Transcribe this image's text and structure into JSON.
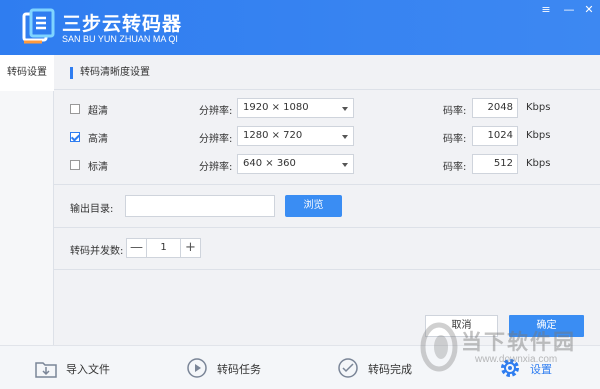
{
  "app": {
    "title": "三步云转码器",
    "subtitle": "SAN BU YUN ZHUAN MA QI",
    "window_controls": {
      "menu": "≡",
      "minimize": "—",
      "close": "✕"
    }
  },
  "sidebar": {
    "items": [
      {
        "label": "转码设置",
        "selected": true
      }
    ]
  },
  "settings": {
    "section_title": "转码清晰度设置",
    "resolution_label": "分辨率:",
    "bitrate_label": "码率:",
    "bitrate_unit": "Kbps",
    "rows": [
      {
        "label": "超清",
        "checked": false,
        "resolution": "1920 × 1080",
        "bitrate": "2048"
      },
      {
        "label": "高清",
        "checked": true,
        "resolution": "1280 × 720",
        "bitrate": "1024"
      },
      {
        "label": "标清",
        "checked": false,
        "resolution": "640 × 360",
        "bitrate": "512"
      }
    ],
    "output_dir": {
      "label": "输出目录:",
      "value": "",
      "browse_label": "浏览"
    },
    "concurrency": {
      "label": "转码并发数:",
      "value": "1",
      "minus": "—",
      "plus": "+"
    },
    "cancel_label": "取消",
    "confirm_label": "确定"
  },
  "bottom_nav": {
    "items": [
      {
        "label": "导入文件",
        "icon": "import-file-icon"
      },
      {
        "label": "转码任务",
        "icon": "task-icon"
      },
      {
        "label": "转码完成",
        "icon": "done-icon"
      },
      {
        "label": "设置",
        "icon": "gear-icon",
        "active": true
      }
    ]
  },
  "watermark": {
    "text": "当下软件园",
    "url": "www.downxia.com"
  },
  "colors": {
    "accent": "#2f7df0",
    "button_blue": "#3a8df3",
    "background": "#f1f2f5"
  }
}
